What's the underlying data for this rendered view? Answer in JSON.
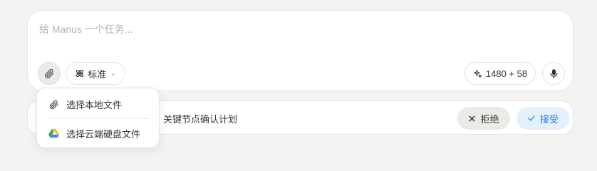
{
  "composer": {
    "placeholder": "给 Manus 一个任务...",
    "mode_label": "标准",
    "credits_label": "1480 + 58"
  },
  "suggestion": {
    "text": "关键节点确认计划",
    "reject_label": "拒绝",
    "accept_label": "接受"
  },
  "attach_menu": {
    "items": [
      {
        "label": "选择本地文件",
        "icon": "paperclip-icon"
      },
      {
        "label": "选择云端硬盘文件",
        "icon": "google-drive-icon"
      }
    ]
  },
  "colors": {
    "background": "#f3f3f2",
    "accent_blue": "#2b7de0",
    "accept_bg": "#e3f0fd",
    "reject_bg": "#eceae7"
  }
}
